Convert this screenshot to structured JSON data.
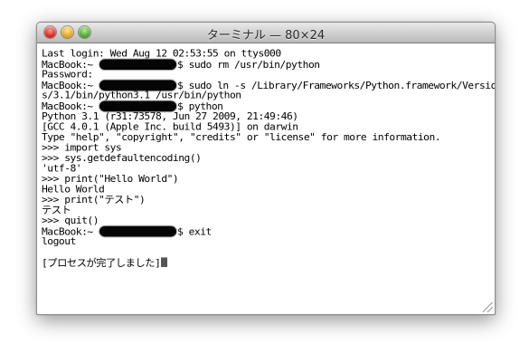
{
  "window": {
    "title": "ターミナル — 80×24"
  },
  "terminal": {
    "lines": [
      {
        "a": "Last login: Wed Aug 12 02:53:55 on ttys000"
      },
      {
        "a": "MacBook:~ ",
        "r": true,
        "b": "$ sudo rm /usr/bin/python"
      },
      {
        "a": "Password:"
      },
      {
        "a": "MacBook:~ ",
        "r": true,
        "b": "$ sudo ln -s /Library/Frameworks/Python.framework/Version"
      },
      {
        "a": "s/3.1/bin/python3.1 /usr/bin/python"
      },
      {
        "a": "MacBook:~ ",
        "r": true,
        "b": "$ python"
      },
      {
        "a": "Python 3.1 (r31:73578, Jun 27 2009, 21:49:46)"
      },
      {
        "a": "[GCC 4.0.1 (Apple Inc. build 5493)] on darwin"
      },
      {
        "a": "Type \"help\", \"copyright\", \"credits\" or \"license\" for more information."
      },
      {
        "a": ">>> import sys"
      },
      {
        "a": ">>> sys.getdefaultencoding()"
      },
      {
        "a": "'utf-8'"
      },
      {
        "a": ">>> print(\"Hello World\")"
      },
      {
        "a": "Hello World"
      },
      {
        "a": ">>> print(\"テスト\")"
      },
      {
        "a": "テスト"
      },
      {
        "a": ">>> quit()"
      },
      {
        "a": "MacBook:~ ",
        "r": true,
        "b": "$ exit"
      },
      {
        "a": "logout"
      },
      {
        "a": ""
      },
      {
        "a": "[プロセスが完了しました]",
        "cursor": true
      }
    ]
  }
}
